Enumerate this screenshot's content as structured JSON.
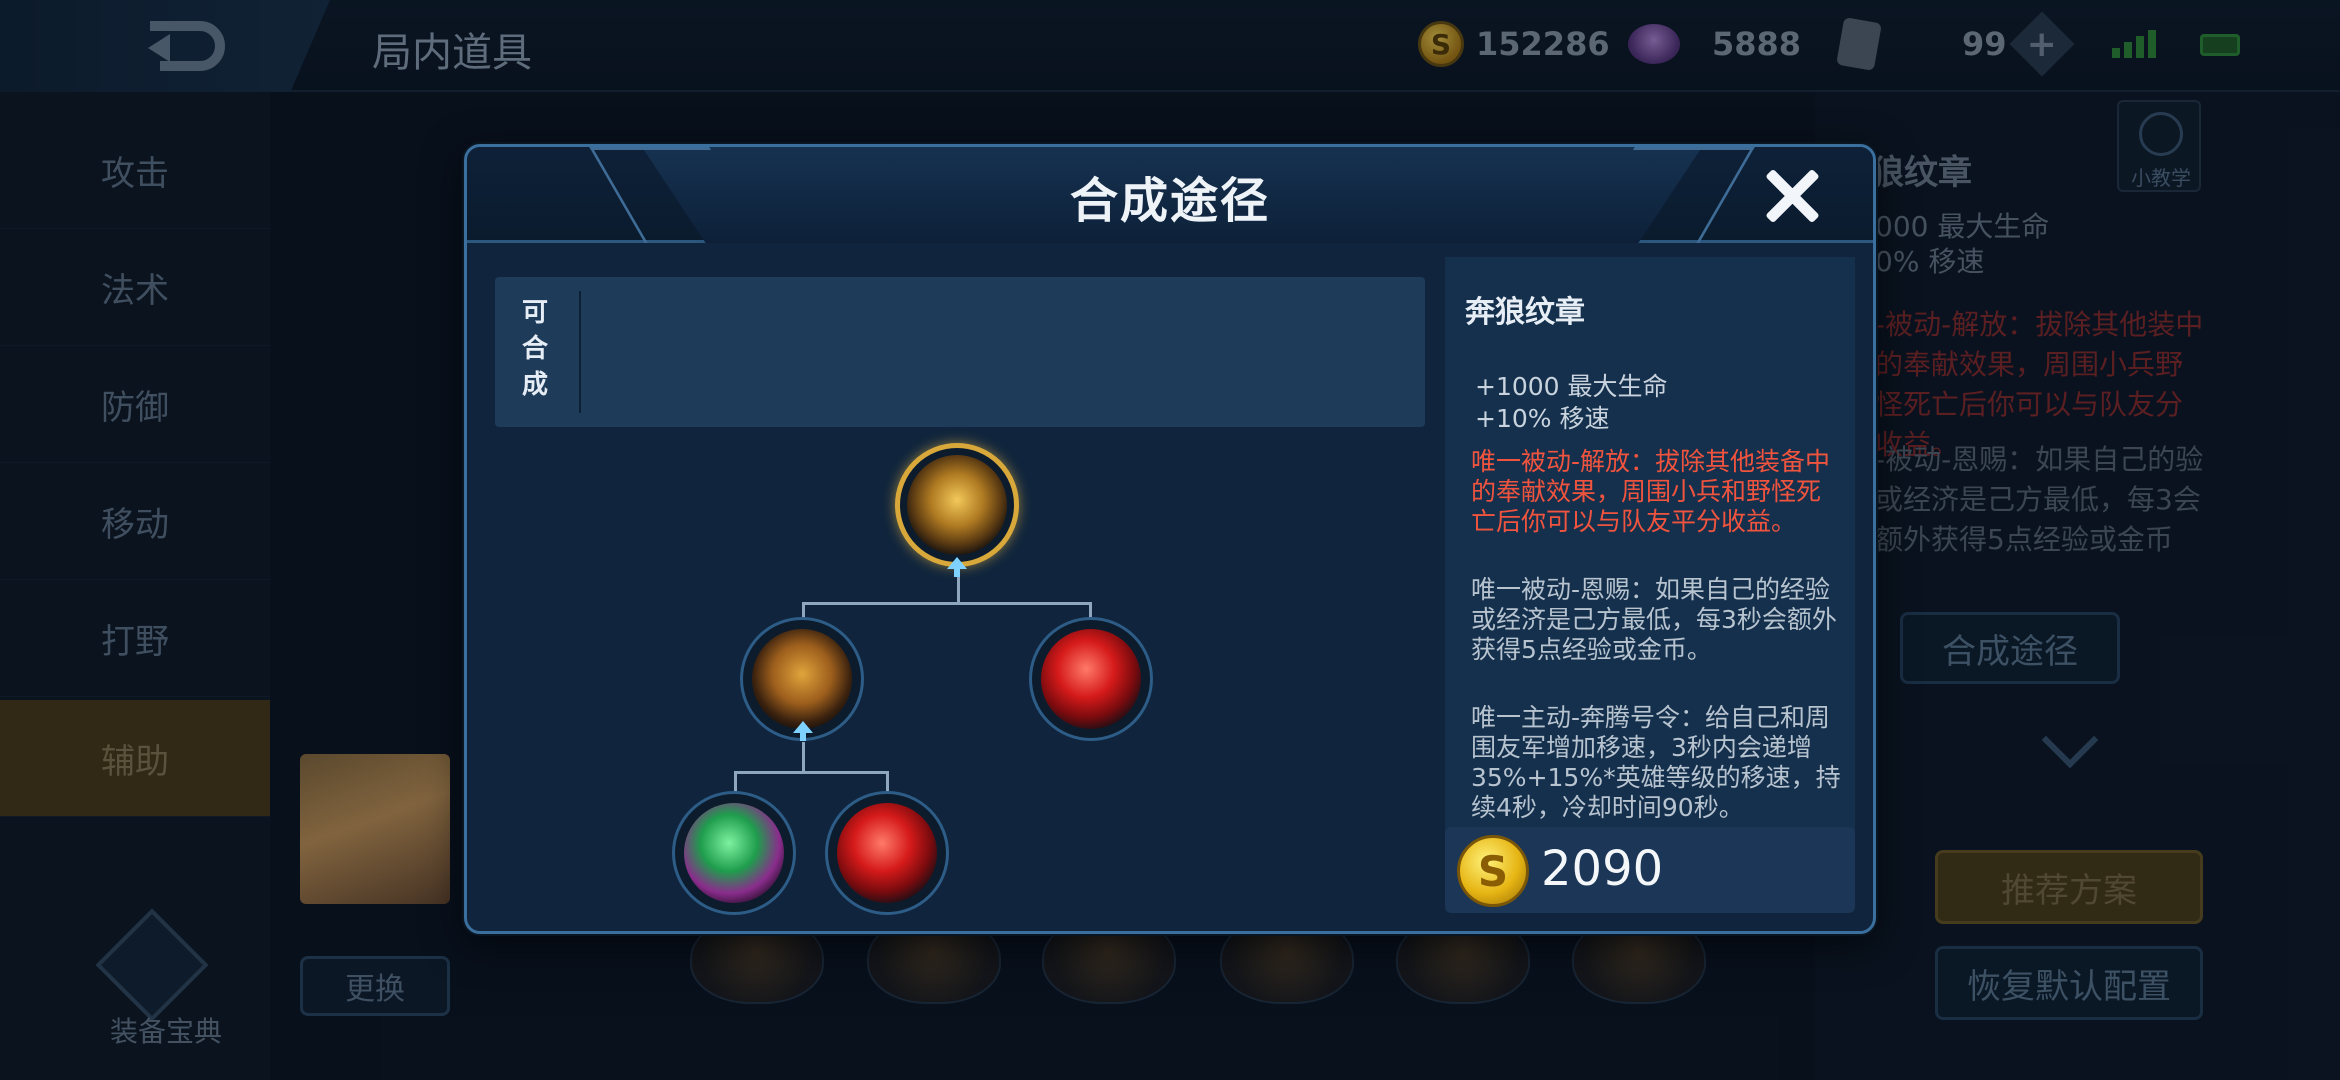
{
  "header": {
    "screen_title": "局内道具",
    "gold": "152286",
    "gems": "5888",
    "tickets": "99",
    "plus_label": "+"
  },
  "categories": [
    {
      "label": "攻击",
      "active": false
    },
    {
      "label": "法术",
      "active": false
    },
    {
      "label": "防御",
      "active": false
    },
    {
      "label": "移动",
      "active": false
    },
    {
      "label": "打野",
      "active": false
    },
    {
      "label": "辅助",
      "active": true
    }
  ],
  "sidebar": {
    "guide_label": "装备宝典"
  },
  "hero": {
    "swap_label": "更换"
  },
  "right_panel": {
    "title": "狼纹章",
    "stat1": "000 最大生命",
    "stat2": "0% 移速",
    "passive1": "-被动-解放：拔除其他装中的奉献效果，周围小兵野怪死亡后你可以与队友分收益。",
    "passive2": "-被动-恩赐：如果自己的验或经济是己方最低，每3会额外获得5点经验或金币",
    "tutorial_label": "小教学",
    "path_button": "合成途径",
    "recommend_button": "推荐方案",
    "reset_button": "恢复默认配置"
  },
  "modal": {
    "title": "合成途径",
    "craftable_label": "可合成",
    "item": {
      "name": "奔狼纹章",
      "stats": [
        "+1000 最大生命",
        "+10% 移速"
      ],
      "passive_release": "唯一被动-解放：拔除其他装备中的奉献效果，周围小兵和野怪死亡后你可以与队友平分收益。",
      "passive_blessing": "唯一被动-恩赐：如果自己的经验或经济是己方最低，每3秒会额外获得5点经验或金币。",
      "active_command": "唯一主动-奔腾号令：给自己和周围友军增加移速，3秒内会递增35%+15%*英雄等级的移速，持续4秒，冷却时间90秒。"
    },
    "price": "2090",
    "tree": {
      "root": "emblem-icon",
      "mid_left": "shield-emblem-icon",
      "mid_right": "ruby-icon",
      "leaf_left": "jade-pendant-icon",
      "leaf_right": "ruby-icon"
    }
  },
  "colors": {
    "accent_gold": "#d8a83a",
    "passive_red": "#f0543e",
    "panel_blue": "#15304d",
    "border_blue": "#3b6f9d"
  }
}
